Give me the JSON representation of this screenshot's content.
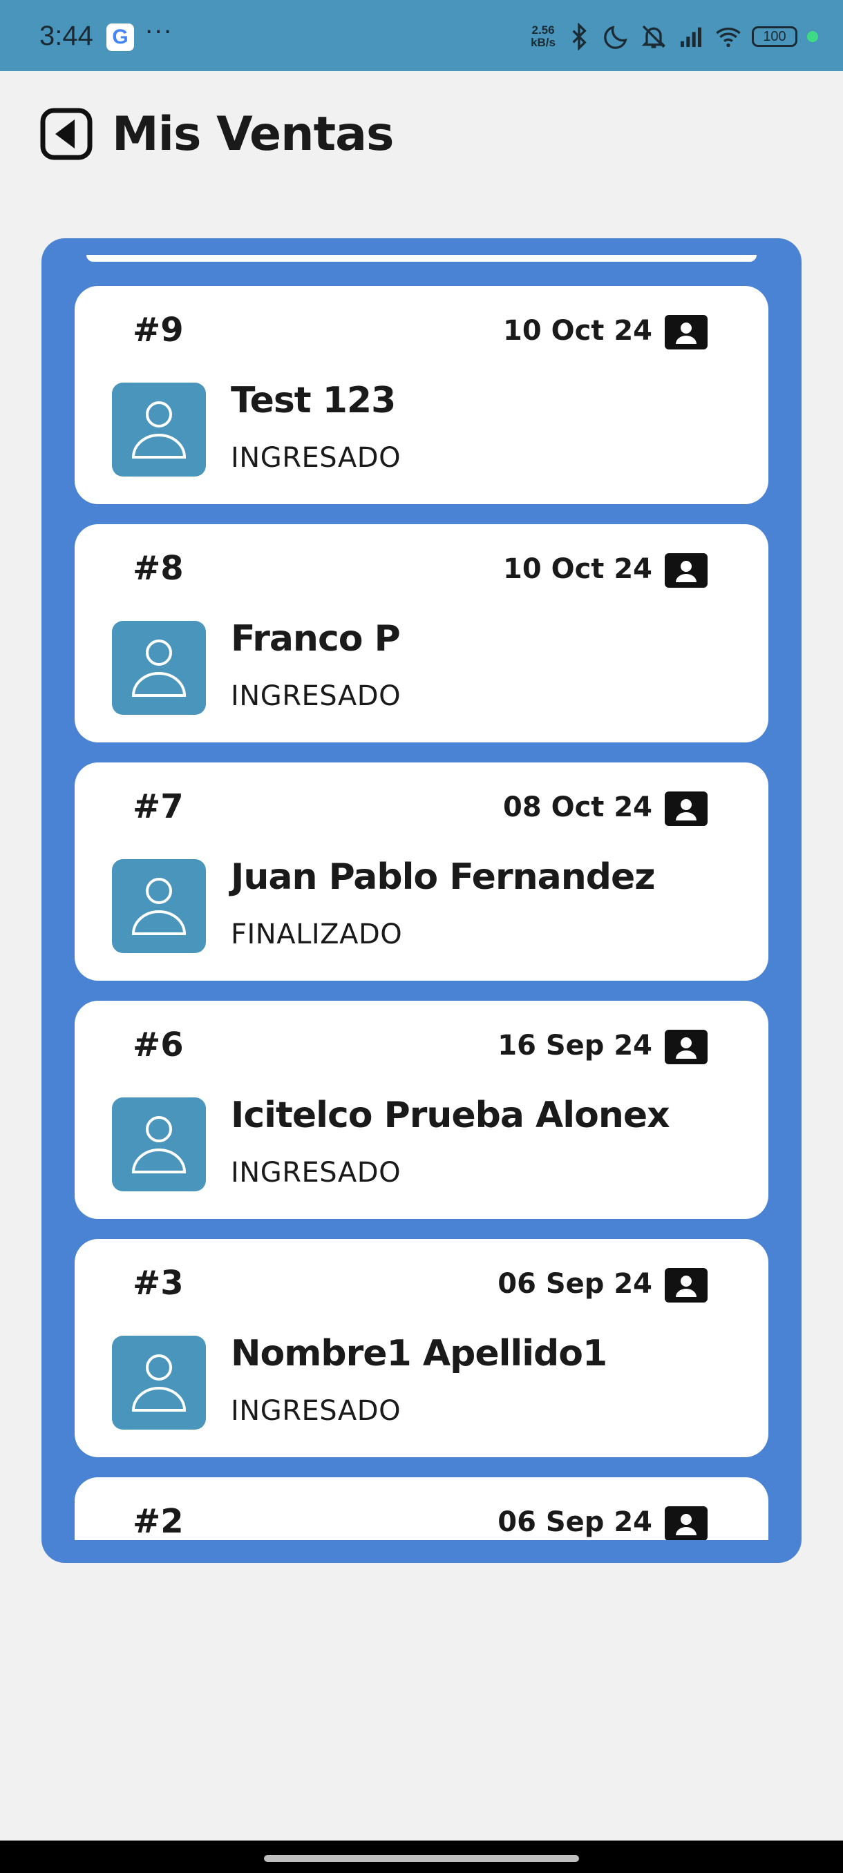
{
  "status_bar": {
    "time": "3:44",
    "google_letter": "G",
    "more": "···",
    "speed_value": "2.56",
    "speed_unit": "kB/s",
    "battery": "100",
    "icons": [
      "google-icon",
      "bluetooth-icon",
      "moon-icon",
      "mute-icon",
      "signal-icon",
      "wifi-icon",
      "battery-icon"
    ]
  },
  "header": {
    "title": "Mis Ventas",
    "back_icon": "back-arrow-icon"
  },
  "colors": {
    "status_bar": "#4a95bb",
    "list_panel": "#4a82d4",
    "card": "#ffffff",
    "avatar": "#4a95bb",
    "background": "#f1f1f1"
  },
  "sales": [
    {
      "number": "#9",
      "date": "10 Oct 24",
      "name": "Test 123",
      "status": "INGRESADO"
    },
    {
      "number": "#8",
      "date": "10 Oct 24",
      "name": "Franco P",
      "status": "INGRESADO"
    },
    {
      "number": "#7",
      "date": "08 Oct 24",
      "name": "Juan Pablo Fernandez",
      "status": "FINALIZADO"
    },
    {
      "number": "#6",
      "date": "16 Sep 24",
      "name": "Icitelco Prueba Alonex",
      "status": "INGRESADO"
    },
    {
      "number": "#3",
      "date": "06 Sep 24",
      "name": "Nombre1 Apellido1",
      "status": "INGRESADO"
    },
    {
      "number": "#2",
      "date": "06 Sep 24",
      "name": "",
      "status": ""
    }
  ]
}
